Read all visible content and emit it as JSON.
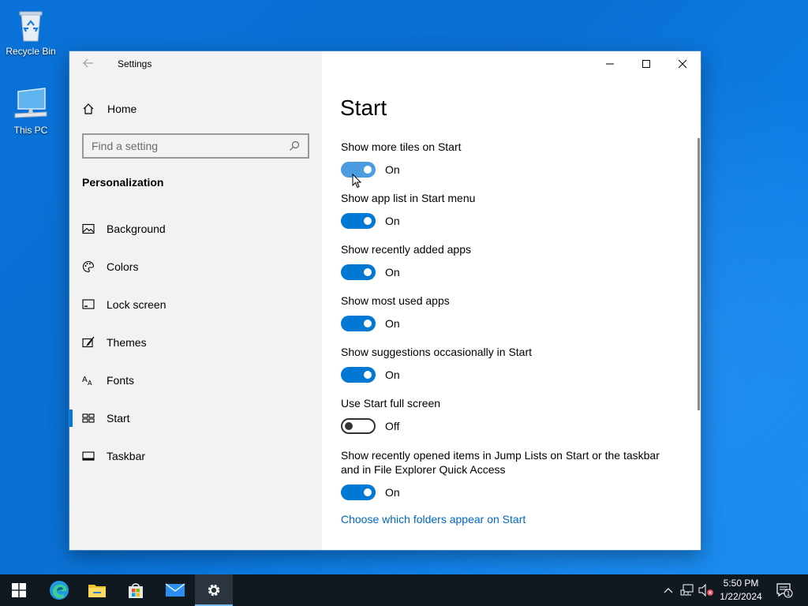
{
  "desktop": {
    "icons": [
      {
        "label": "Recycle Bin",
        "icon": "recycle-bin-icon"
      },
      {
        "label": "This PC",
        "icon": "computer-icon"
      }
    ]
  },
  "window": {
    "app_title": "Settings",
    "home_label": "Home",
    "search_placeholder": "Find a setting",
    "section_heading": "Personalization",
    "nav_items": [
      {
        "label": "Background",
        "icon": "picture-icon",
        "selected": false
      },
      {
        "label": "Colors",
        "icon": "palette-icon",
        "selected": false
      },
      {
        "label": "Lock screen",
        "icon": "lock-screen-icon",
        "selected": false
      },
      {
        "label": "Themes",
        "icon": "themes-brush-icon",
        "selected": false
      },
      {
        "label": "Fonts",
        "icon": "font-icon",
        "selected": false
      },
      {
        "label": "Start",
        "icon": "start-tiles-icon",
        "selected": true
      },
      {
        "label": "Taskbar",
        "icon": "taskbar-icon",
        "selected": false
      }
    ],
    "page_title": "Start",
    "settings": [
      {
        "label": "Show more tiles on Start",
        "state": "On",
        "on": true
      },
      {
        "label": "Show app list in Start menu",
        "state": "On",
        "on": true
      },
      {
        "label": "Show recently added apps",
        "state": "On",
        "on": true
      },
      {
        "label": "Show most used apps",
        "state": "On",
        "on": true
      },
      {
        "label": "Show suggestions occasionally in Start",
        "state": "On",
        "on": true
      },
      {
        "label": "Use Start full screen",
        "state": "Off",
        "on": false
      },
      {
        "label": "Show recently opened items in Jump Lists on Start or the taskbar and in File Explorer Quick Access",
        "state": "On",
        "on": true
      }
    ],
    "folders_link": "Choose which folders appear on Start",
    "accent_color": "#0078d4",
    "link_color": "#0067c0"
  },
  "taskbar": {
    "apps": [
      "windows-start-icon",
      "edge-icon",
      "file-explorer-icon",
      "store-icon",
      "mail-icon",
      "settings-gear-icon"
    ],
    "time": "5:50 PM",
    "date": "1/22/2024",
    "notification_count": "1"
  }
}
